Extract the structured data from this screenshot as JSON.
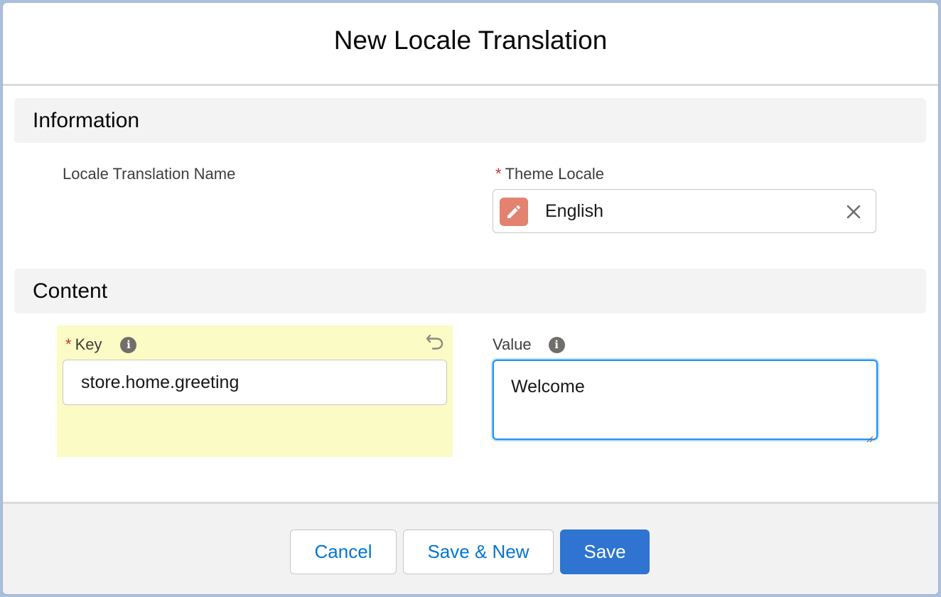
{
  "modal": {
    "title": "New Locale Translation"
  },
  "sections": {
    "information": "Information",
    "content": "Content"
  },
  "fields": {
    "locale_translation_name": {
      "label": "Locale Translation Name"
    },
    "theme_locale": {
      "label": "Theme Locale",
      "required_marker": "*",
      "value": "English",
      "icon": "pencil-icon"
    },
    "key": {
      "label": "Key",
      "required_marker": "*",
      "value": "store.home.greeting",
      "info_icon": "i"
    },
    "value": {
      "label": "Value",
      "value": "Welcome",
      "info_icon": "i"
    }
  },
  "footer": {
    "cancel_label": "Cancel",
    "save_new_label": "Save & New",
    "save_label": "Save"
  },
  "colors": {
    "brand": "#2e74d0",
    "required": "#c23934",
    "highlight": "#fafbc5",
    "lookup_icon_bg": "#e2826f",
    "focus": "#1b96ff"
  }
}
